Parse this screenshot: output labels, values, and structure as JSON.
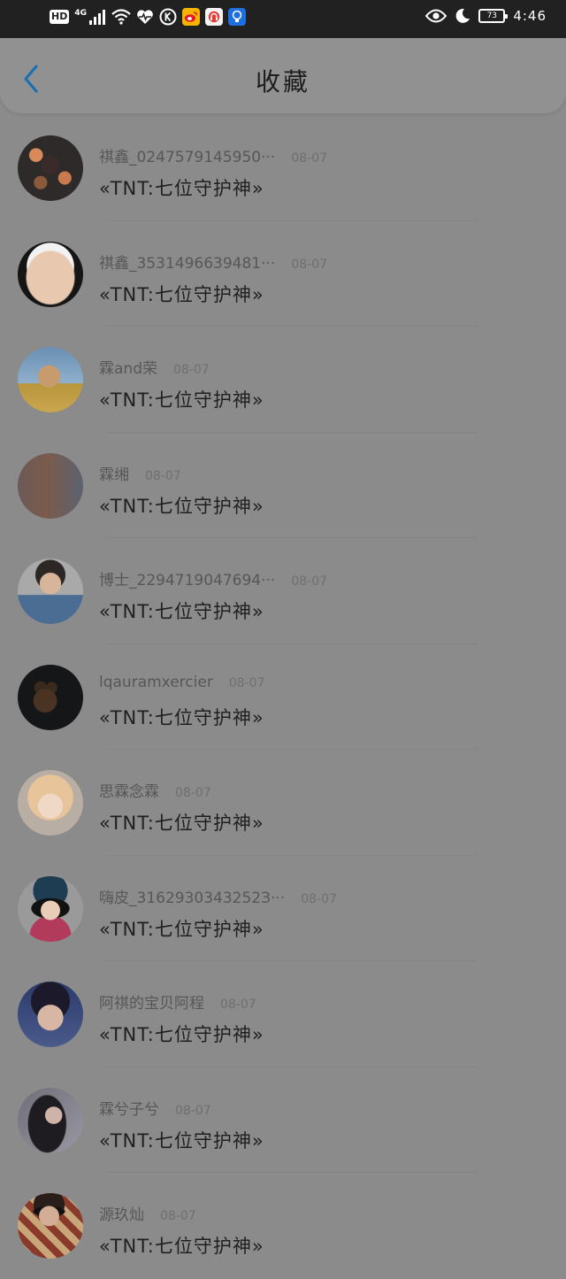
{
  "status_bar": {
    "hd": "HD",
    "network": "4G",
    "battery_level": "73",
    "time": "4:46"
  },
  "header": {
    "title": "收藏",
    "back_icon": "chevron-left-icon",
    "accent_color": "#1a6fb3"
  },
  "favorites": [
    {
      "name": "祺鑫_0247579145950···",
      "date": "08-07",
      "title": "«TNT:七位守护神»"
    },
    {
      "name": "祺鑫_3531496639481···",
      "date": "08-07",
      "title": "«TNT:七位守护神»"
    },
    {
      "name": "霖and荣",
      "date": "08-07",
      "title": "«TNT:七位守护神»"
    },
    {
      "name": "霖缃",
      "date": "08-07",
      "title": "«TNT:七位守护神»"
    },
    {
      "name": "博士_2294719047694···",
      "date": "08-07",
      "title": "«TNT:七位守护神»"
    },
    {
      "name": "lqauramxercier",
      "date": "08-07",
      "title": "«TNT:七位守护神»"
    },
    {
      "name": "思霖念霖",
      "date": "08-07",
      "title": "«TNT:七位守护神»"
    },
    {
      "name": "嗨皮_3162930343252З···",
      "date": "08-07",
      "title": "«TNT:七位守护神»"
    },
    {
      "name": "阿祺的宝贝阿程",
      "date": "08-07",
      "title": "«TNT:七位守护神»"
    },
    {
      "name": "霖兮子兮",
      "date": "08-07",
      "title": "«TNT:七位守护神»"
    },
    {
      "name": "源玖灿",
      "date": "08-07",
      "title": "«TNT:七位守护神»"
    }
  ]
}
